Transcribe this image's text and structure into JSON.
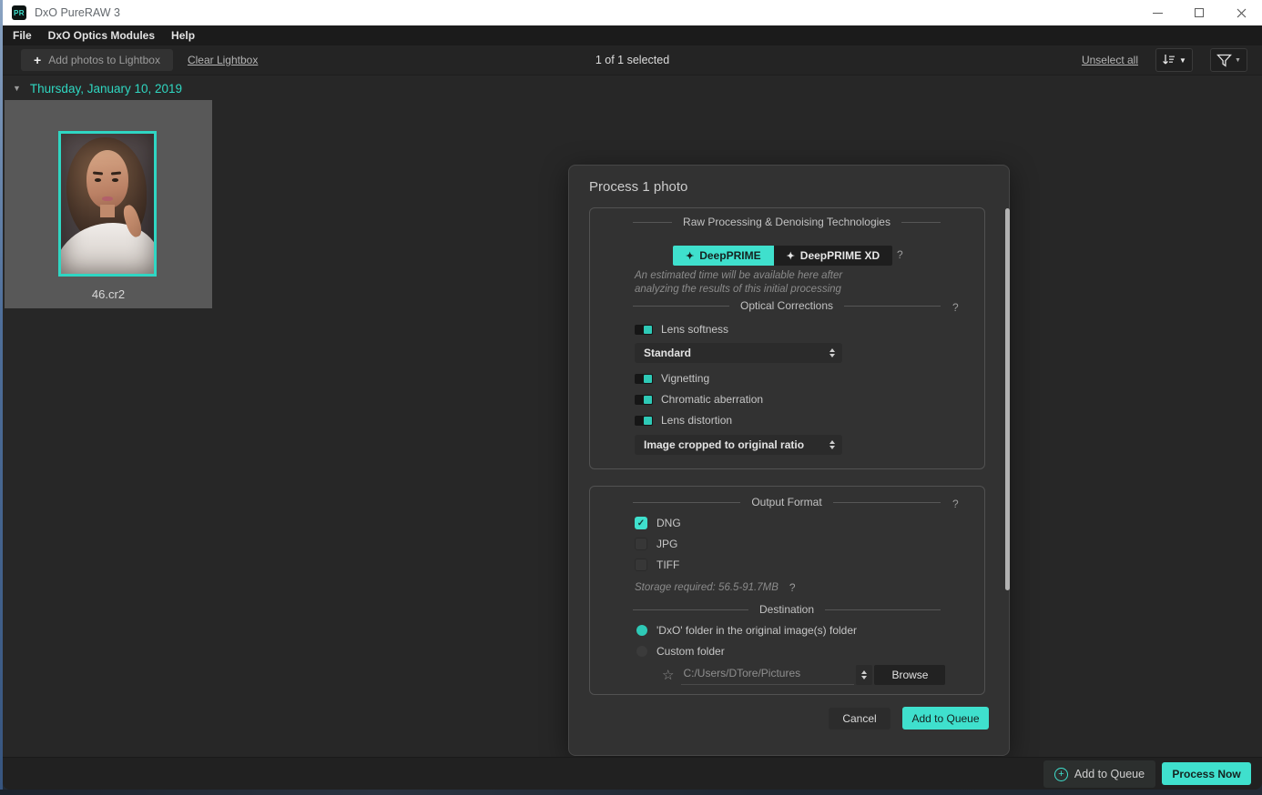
{
  "window": {
    "title": "DxO PureRAW 3",
    "logo": "PR"
  },
  "menu": {
    "items": [
      "File",
      "DxO Optics Modules",
      "Help"
    ]
  },
  "toolbar": {
    "add_photos_label": "Add photos to Lightbox",
    "clear_lightbox_label": "Clear Lightbox",
    "selection_status": "1 of 1 selected",
    "unselect_all_label": "Unselect all"
  },
  "lightbox": {
    "date_header": "Thursday, January 10, 2019",
    "photo_filename": "46.cr2"
  },
  "dialog": {
    "title": "Process 1 photo",
    "raw": {
      "header": "Raw Processing & Denoising Technologies",
      "deepprime_label": "DeepPRIME",
      "deepprime_xd_label": "DeepPRIME XD",
      "selected_mode": "DeepPRIME",
      "help": "?",
      "note1": "An estimated time will be available here after",
      "note2": "analyzing the results of this initial processing"
    },
    "optical": {
      "header": "Optical Corrections",
      "help": "?",
      "toggles": [
        {
          "label": "Lens softness",
          "on": true
        },
        {
          "label": "Vignetting",
          "on": true
        },
        {
          "label": "Chromatic aberration",
          "on": true
        },
        {
          "label": "Lens distortion",
          "on": true
        }
      ],
      "softness_value": "Standard",
      "crop_value": "Image cropped to original ratio"
    },
    "output": {
      "header": "Output Format",
      "help": "?",
      "formats": [
        {
          "label": "DNG",
          "checked": true
        },
        {
          "label": "JPG",
          "checked": false
        },
        {
          "label": "TIFF",
          "checked": false
        }
      ],
      "storage_note": "Storage required: 56.5-91.7MB",
      "storage_help": "?"
    },
    "destination": {
      "header": "Destination",
      "options": [
        {
          "label": "'DxO' folder in the original image(s) folder",
          "selected": true
        },
        {
          "label": "Custom folder",
          "selected": false
        }
      ],
      "custom_path": "C:/Users/DTore/Pictures",
      "browse_label": "Browse"
    },
    "footer": {
      "cancel_label": "Cancel",
      "add_to_queue_label": "Add to Queue"
    }
  },
  "bottom_bar": {
    "add_to_queue_label": "Add to Queue",
    "process_now_label": "Process Now"
  },
  "icons": {
    "sparkle": "✦",
    "caret_down": "▼",
    "collapse_triangle": "▼",
    "star": "☆",
    "plus": "+",
    "check": "✓"
  },
  "colors": {
    "accent_teal": "#3fe0cd",
    "date_header_teal": "#2fd7c1",
    "selection_border_teal": "#2fd6c3",
    "titlebar_white": "#ffffff",
    "app_background": "#272727",
    "dialog_background": "#323232",
    "thumbnail_card_gray": "#585858"
  }
}
